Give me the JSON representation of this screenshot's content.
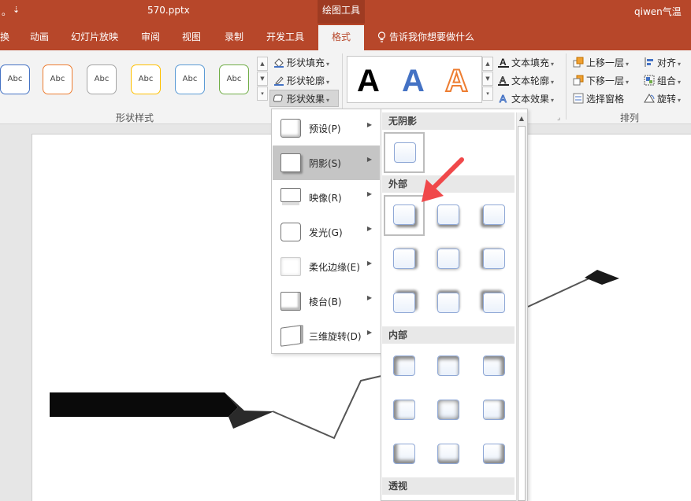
{
  "title_bar": {
    "left_fragment": "。",
    "qat_caret": "⇣",
    "file_name": "570.pptx",
    "contextual_tab": "绘图工具",
    "user": "qiwen气温"
  },
  "tabs": [
    {
      "label": "换"
    },
    {
      "label": "动画"
    },
    {
      "label": "幻灯片放映"
    },
    {
      "label": "审阅"
    },
    {
      "label": "视图"
    },
    {
      "label": "录制"
    },
    {
      "label": "开发工具"
    },
    {
      "label": "格式"
    }
  ],
  "tell_me": "告诉我你想要做什么",
  "shape_styles": {
    "swatch_label": "Abc",
    "group_label": "形状样式",
    "colors": [
      "#4472c4",
      "#ed7d31",
      "#a5a5a5",
      "#ffc000",
      "#5b9bd5",
      "#70ad47"
    ]
  },
  "shape_commands": {
    "fill": "形状填充",
    "outline": "形状轮廓",
    "effects": "形状效果"
  },
  "wordart": {
    "letter": "A",
    "fill": "文本填充",
    "outline": "文本轮廓",
    "effects": "文本效果"
  },
  "arrange": {
    "forward": "上移一层",
    "backward": "下移一层",
    "pane": "选择窗格",
    "align": "对齐",
    "group": "组合",
    "rotate": "旋转",
    "group_label": "排列"
  },
  "effects_menu": [
    {
      "label": "预设(P)"
    },
    {
      "label": "阴影(S)"
    },
    {
      "label": "映像(R)"
    },
    {
      "label": "发光(G)"
    },
    {
      "label": "柔化边缘(E)"
    },
    {
      "label": "棱台(B)"
    },
    {
      "label": "三维旋转(D)"
    }
  ],
  "shadow_panel": {
    "no_shadow": "无阴影",
    "outer": "外部",
    "inner": "内部",
    "perspective": "透视"
  },
  "colors": {
    "accent": "#b7472a",
    "pointer_arrow": "#f0484a"
  }
}
